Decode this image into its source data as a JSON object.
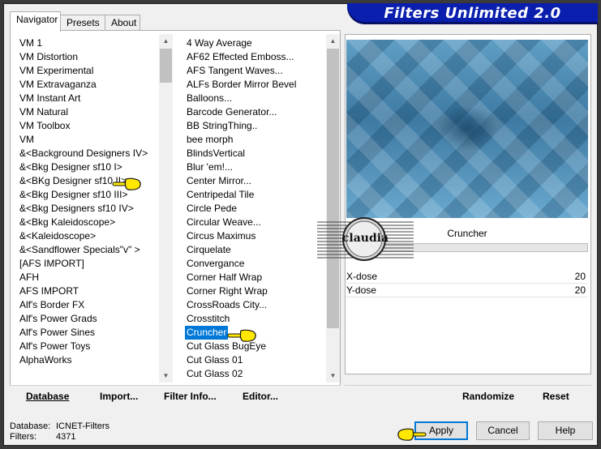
{
  "window": {
    "title": "Filters Unlimited 2.0"
  },
  "tabs": [
    {
      "label": "Navigator",
      "active": true
    },
    {
      "label": "Presets",
      "active": false
    },
    {
      "label": "About",
      "active": false
    }
  ],
  "categories": [
    "VM 1",
    "VM Distortion",
    "VM Experimental",
    "VM Extravaganza",
    "VM Instant Art",
    "VM Natural",
    "VM Toolbox",
    "VM",
    "&<Background Designers IV>",
    "&<Bkg Designer sf10 I>",
    "&<BKg Designer sf10 II>",
    "&<Bkg Designer sf10 III>",
    "&<Bkg Designers sf10 IV>",
    "&<Bkg Kaleidoscope>",
    "&<Kaleidoscope>",
    "&<Sandflower Specials\"v\" >",
    "[AFS IMPORT]",
    "AFH",
    "AFS IMPORT",
    "Alf's Border FX",
    "Alf's Power Grads",
    "Alf's Power Sines",
    "Alf's Power Toys",
    "AlphaWorks"
  ],
  "filters": [
    "4 Way Average",
    "AF62 Effected Emboss...",
    "AFS Tangent Waves...",
    "ALFs Border Mirror Bevel",
    "Balloons...",
    "Barcode Generator...",
    "BB StringThing..",
    "bee morph",
    "BlindsVertical",
    "Blur 'em!...",
    "Center Mirror...",
    "Centripedal Tile",
    "Circle Pede",
    "Circular Weave...",
    "Circus Maximus",
    "Cirquelate",
    "Convergance",
    "Corner Half Wrap",
    "Corner Right Wrap",
    "CrossRoads City...",
    "Crosstitch",
    "Cruncher",
    "Cut Glass  BugEye",
    "Cut Glass 01",
    "Cut Glass 02"
  ],
  "selected_filter": "Cruncher",
  "preview": {
    "filter_name": "Cruncher",
    "params": [
      {
        "label": "X-dose",
        "value": "20"
      },
      {
        "label": "Y-dose",
        "value": "20"
      }
    ]
  },
  "left_buttons": {
    "database": "Database",
    "import": "Import...",
    "filter_info": "Filter Info...",
    "editor": "Editor..."
  },
  "right_buttons": {
    "randomize": "Randomize",
    "reset": "Reset"
  },
  "status": {
    "database_label": "Database:",
    "database_value": "ICNET-Filters",
    "filters_label": "Filters:",
    "filters_value": "4371"
  },
  "dialog_buttons": {
    "apply": "Apply",
    "cancel": "Cancel",
    "help": "Help"
  },
  "watermark": "claudia",
  "colors": {
    "title_band": "#0a1fae",
    "selection": "#0078d7"
  }
}
